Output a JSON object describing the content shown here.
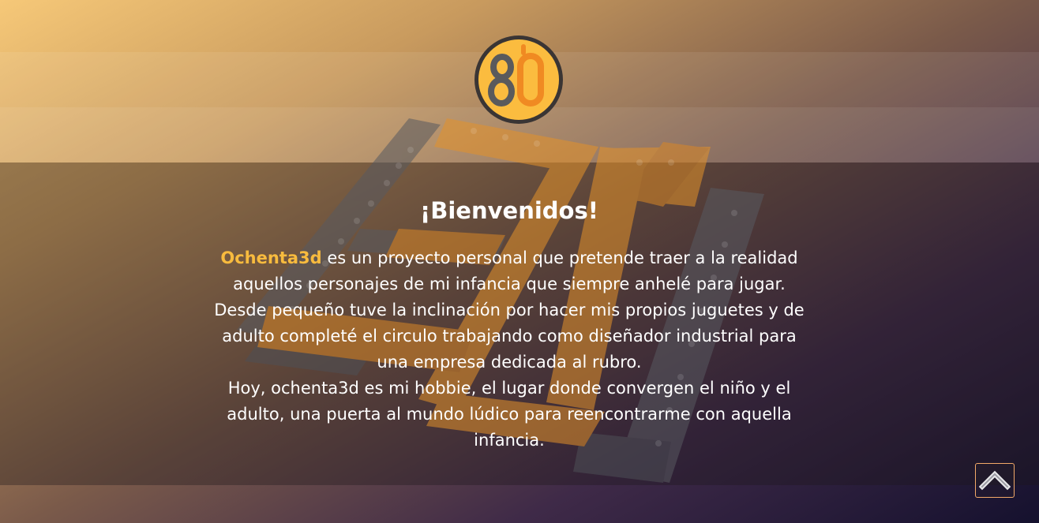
{
  "brand": {
    "logo_icon": "ochenta3d-80-logo-icon",
    "accent_color": "#f8bb3e"
  },
  "welcome": {
    "title": "¡Bienvenidos!",
    "brand_name": "Ochenta3d",
    "body": " es un proyecto personal que pretende traer a la realidad aquellos personajes de mi infancia que siempre anhelé para jugar. Desde pequeño tuve la inclinación por hacer mis propios juguetes y de adulto completé el circulo trabajando como diseñador industrial para una empresa dedicada al rubro.",
    "body_2": "Hoy, ochenta3d es mi hobbie, el lugar donde convergen el niño y el adulto, una puerta al mundo lúdico para reencontrarme con aquella infancia."
  },
  "scroll_top": {
    "icon": "chevron-up-icon",
    "border_color": "#f2a968"
  }
}
